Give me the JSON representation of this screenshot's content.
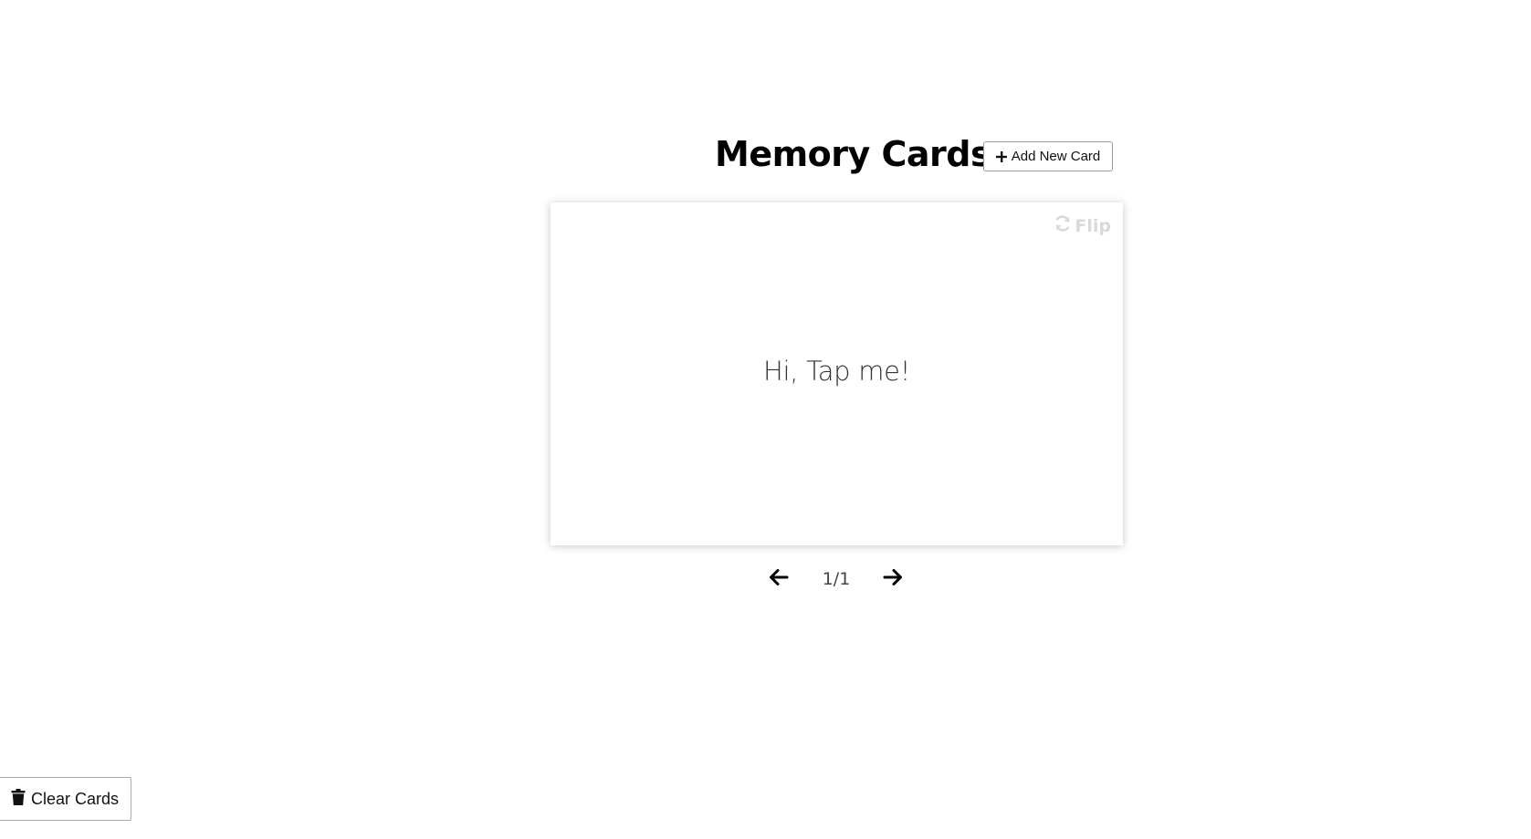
{
  "header": {
    "title": "Memory Cards",
    "add_button_label": "Add New Card",
    "add_button_icon": "plus-icon"
  },
  "card": {
    "flip_label": "Flip",
    "flip_icon": "sync-icon",
    "text": "Hi, Tap me!"
  },
  "navigation": {
    "prev_icon": "arrow-left-icon",
    "next_icon": "arrow-right-icon",
    "counter": "1/1"
  },
  "footer": {
    "clear_button_label": "Clear Cards",
    "clear_button_icon": "trash-icon"
  },
  "colors": {
    "background": "#ffffff",
    "flip_text": "#d9d9d9",
    "card_text": "#333333"
  }
}
